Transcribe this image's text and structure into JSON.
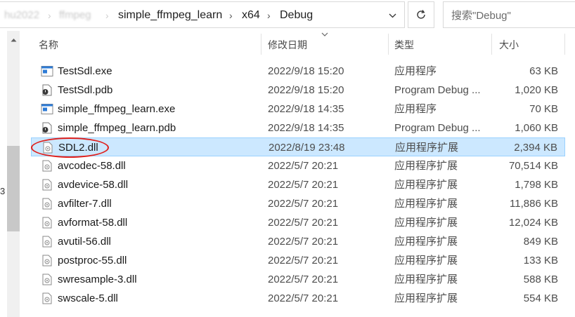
{
  "address_bar": {
    "faded_crumbs": [
      "hu2022",
      "ffmpeg"
    ],
    "crumbs": [
      "simple_ffmpeg_learn",
      "x64",
      "Debug"
    ],
    "dropdown_icon": "chevron-down",
    "refresh_icon": "refresh"
  },
  "search": {
    "placeholder": "搜索\"Debug\""
  },
  "nav_pane": {
    "partial_text": "3"
  },
  "columns": {
    "name": "名称",
    "date": "修改日期",
    "type": "类型",
    "size": "大小"
  },
  "files": [
    {
      "name": "TestSdl.exe",
      "date": "2022/9/18 15:20",
      "type": "应用程序",
      "size": "63 KB",
      "icon": "exe-icon"
    },
    {
      "name": "TestSdl.pdb",
      "date": "2022/9/18 15:20",
      "type": "Program Debug ...",
      "size": "1,020 KB",
      "icon": "pdb-icon"
    },
    {
      "name": "simple_ffmpeg_learn.exe",
      "date": "2022/9/18 14:35",
      "type": "应用程序",
      "size": "70 KB",
      "icon": "exe-icon"
    },
    {
      "name": "simple_ffmpeg_learn.pdb",
      "date": "2022/9/18 14:35",
      "type": "Program Debug ...",
      "size": "1,060 KB",
      "icon": "pdb-icon"
    },
    {
      "name": "SDL2.dll",
      "date": "2022/8/19 23:48",
      "type": "应用程序扩展",
      "size": "2,394 KB",
      "icon": "dll-icon",
      "selected": true
    },
    {
      "name": "avcodec-58.dll",
      "date": "2022/5/7 20:21",
      "type": "应用程序扩展",
      "size": "70,514 KB",
      "icon": "dll-icon"
    },
    {
      "name": "avdevice-58.dll",
      "date": "2022/5/7 20:21",
      "type": "应用程序扩展",
      "size": "1,798 KB",
      "icon": "dll-icon"
    },
    {
      "name": "avfilter-7.dll",
      "date": "2022/5/7 20:21",
      "type": "应用程序扩展",
      "size": "11,886 KB",
      "icon": "dll-icon"
    },
    {
      "name": "avformat-58.dll",
      "date": "2022/5/7 20:21",
      "type": "应用程序扩展",
      "size": "12,024 KB",
      "icon": "dll-icon"
    },
    {
      "name": "avutil-56.dll",
      "date": "2022/5/7 20:21",
      "type": "应用程序扩展",
      "size": "849 KB",
      "icon": "dll-icon"
    },
    {
      "name": "postproc-55.dll",
      "date": "2022/5/7 20:21",
      "type": "应用程序扩展",
      "size": "133 KB",
      "icon": "dll-icon"
    },
    {
      "name": "swresample-3.dll",
      "date": "2022/5/7 20:21",
      "type": "应用程序扩展",
      "size": "588 KB",
      "icon": "dll-icon"
    },
    {
      "name": "swscale-5.dll",
      "date": "2022/5/7 20:21",
      "type": "应用程序扩展",
      "size": "554 KB",
      "icon": "dll-icon"
    }
  ],
  "colors": {
    "selection_bg": "#cce8ff",
    "selection_border": "#99d1ff",
    "annotation_red": "#e0201b"
  }
}
